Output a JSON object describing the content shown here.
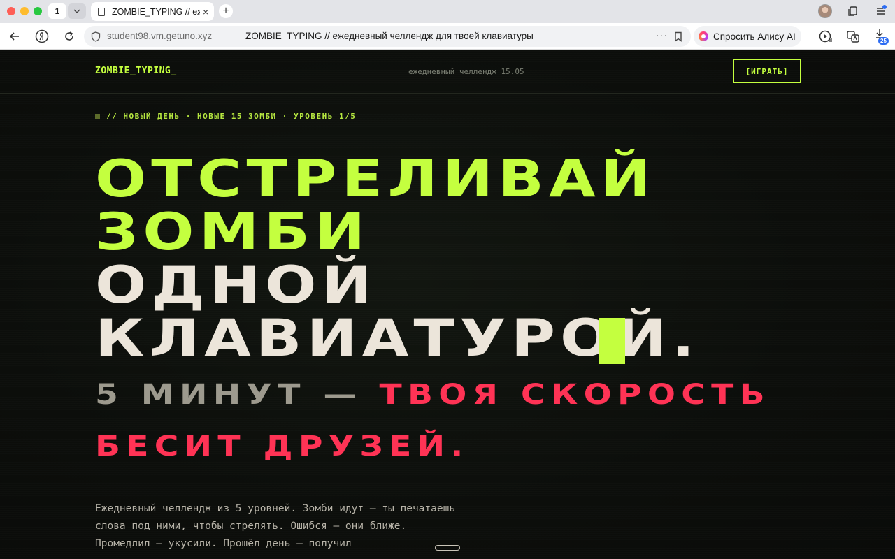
{
  "browser": {
    "tab_count": "1",
    "tab_title": "ZOMBIE_TYPING // ежедневный челлендж для твоей клавиатуры",
    "url_domain": "student98.vm.getuno.xyz",
    "page_title": "ZOMBIE_TYPING // ежедневный челлендж для твоей клавиатуры",
    "alice_label": "Спросить Алису AI",
    "downloads_badge": "25",
    "tab_close": "×",
    "new_tab": "+",
    "more": "···",
    "icons": [
      "back-icon",
      "yandex-icon",
      "reload-icon",
      "shield-icon",
      "bookmark-icon",
      "alice-icon",
      "video-icon",
      "translate-icon",
      "download-icon",
      "collections-icon",
      "menu-icon"
    ]
  },
  "site": {
    "logo": "ZOMBIE_TYPING_",
    "header_date": "ежедневный челлендж 15.05",
    "play_label": "[ИГРАТЬ]",
    "eyebrow": "// НОВЫЙ ДЕНЬ · НОВЫЕ 15 ЗОМБИ · УРОВЕНЬ 1/5",
    "headline": {
      "line1": "ОТСТРЕЛИВАЙ",
      "line2": "ЗОМБИ",
      "line3": "ОДНОЙ",
      "line4": "КЛАВИАТУРОЙ."
    },
    "subline": {
      "gray_part": "5 МИНУТ —",
      "red_part_1": "ТВОЯ СКОРОСТЬ",
      "red_part_2": "БЕСИТ ДРУЗЕЙ."
    },
    "description": "Ежедневный челлендж из 5 уровней. Зомби идут — ты печатаешь слова под ними, чтобы стрелять. Ошибся — они ближе. Промедлил — укусили. Прошёл день — получил",
    "colors": {
      "accent": "#c4ff3f",
      "danger": "#ff3355",
      "text": "#ece5da",
      "background": "#0c0e0b"
    }
  }
}
